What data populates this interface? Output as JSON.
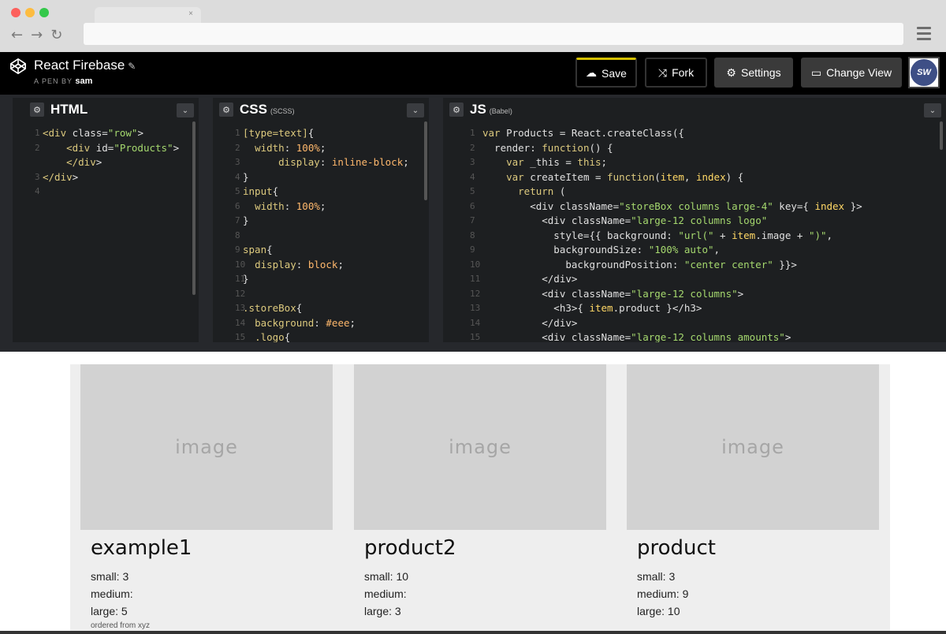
{
  "browser": {
    "tab_close": "×"
  },
  "header": {
    "title": "React Firebase",
    "by_prefix": "A PEN BY",
    "author": "sam",
    "buttons": {
      "save": "Save",
      "fork": "Fork",
      "settings": "Settings",
      "change_view": "Change View"
    },
    "avatar_text": "SW"
  },
  "editors": {
    "html": {
      "title": "HTML",
      "sub": ""
    },
    "css": {
      "title": "CSS",
      "sub": "(SCSS)"
    },
    "js": {
      "title": "JS",
      "sub": "(Babel)"
    }
  },
  "html_lines": [
    {
      "n": "1",
      "code": "<div class=\"row\">"
    },
    {
      "n": "2",
      "code": "    <div id=\"Products\">"
    },
    {
      "n": "",
      "code": "    </div>"
    },
    {
      "n": "3",
      "code": "</div>"
    },
    {
      "n": "4",
      "code": ""
    }
  ],
  "css_lines": [
    {
      "n": "1",
      "code": "[type=text]{"
    },
    {
      "n": "2",
      "code": "  width: 100%;"
    },
    {
      "n": "3",
      "code": "      display: inline-block;"
    },
    {
      "n": "4",
      "code": "}"
    },
    {
      "n": "5",
      "code": "input{"
    },
    {
      "n": "6",
      "code": "  width: 100%;"
    },
    {
      "n": "7",
      "code": "}"
    },
    {
      "n": "8",
      "code": ""
    },
    {
      "n": "9",
      "code": "span{"
    },
    {
      "n": "10",
      "code": "  display: block;"
    },
    {
      "n": "11",
      "code": "}"
    },
    {
      "n": "12",
      "code": ""
    },
    {
      "n": "13",
      "code": ".storeBox{"
    },
    {
      "n": "14",
      "code": "  background: #eee;"
    },
    {
      "n": "15",
      "code": "  .logo{"
    }
  ],
  "js_lines": [
    {
      "n": "1",
      "code": "var Products = React.createClass({"
    },
    {
      "n": "2",
      "code": "  render: function() {"
    },
    {
      "n": "3",
      "code": "    var _this = this;"
    },
    {
      "n": "4",
      "code": "    var createItem = function(item, index) {"
    },
    {
      "n": "5",
      "code": "      return ("
    },
    {
      "n": "6",
      "code": "        <div className=\"storeBox columns large-4\" key={ index }>"
    },
    {
      "n": "7",
      "code": "          <div className=\"large-12 columns logo\""
    },
    {
      "n": "8",
      "code": "            style={{ background: \"url(\" + item.image + \")\","
    },
    {
      "n": "9",
      "code": "            backgroundSize: \"100% auto\","
    },
    {
      "n": "10",
      "code": "              backgroundPosition: \"center center\" }}>"
    },
    {
      "n": "11",
      "code": "          </div>"
    },
    {
      "n": "12",
      "code": "          <div className=\"large-12 columns\">"
    },
    {
      "n": "13",
      "code": "            <h3>{ item.product }</h3>"
    },
    {
      "n": "14",
      "code": "          </div>"
    },
    {
      "n": "15",
      "code": "          <div className=\"large-12 columns amounts\">"
    }
  ],
  "products": [
    {
      "image": "image",
      "name": "example1",
      "small": "small: 3",
      "medium": "medium:",
      "large": "large: 5",
      "note": "ordered from xyz"
    },
    {
      "image": "image",
      "name": "product2",
      "small": "small: 10",
      "medium": "medium:",
      "large": "large: 3",
      "note": ""
    },
    {
      "image": "image",
      "name": "product",
      "small": "small: 3",
      "medium": "medium: 9",
      "large": "large: 10",
      "note": ""
    }
  ]
}
